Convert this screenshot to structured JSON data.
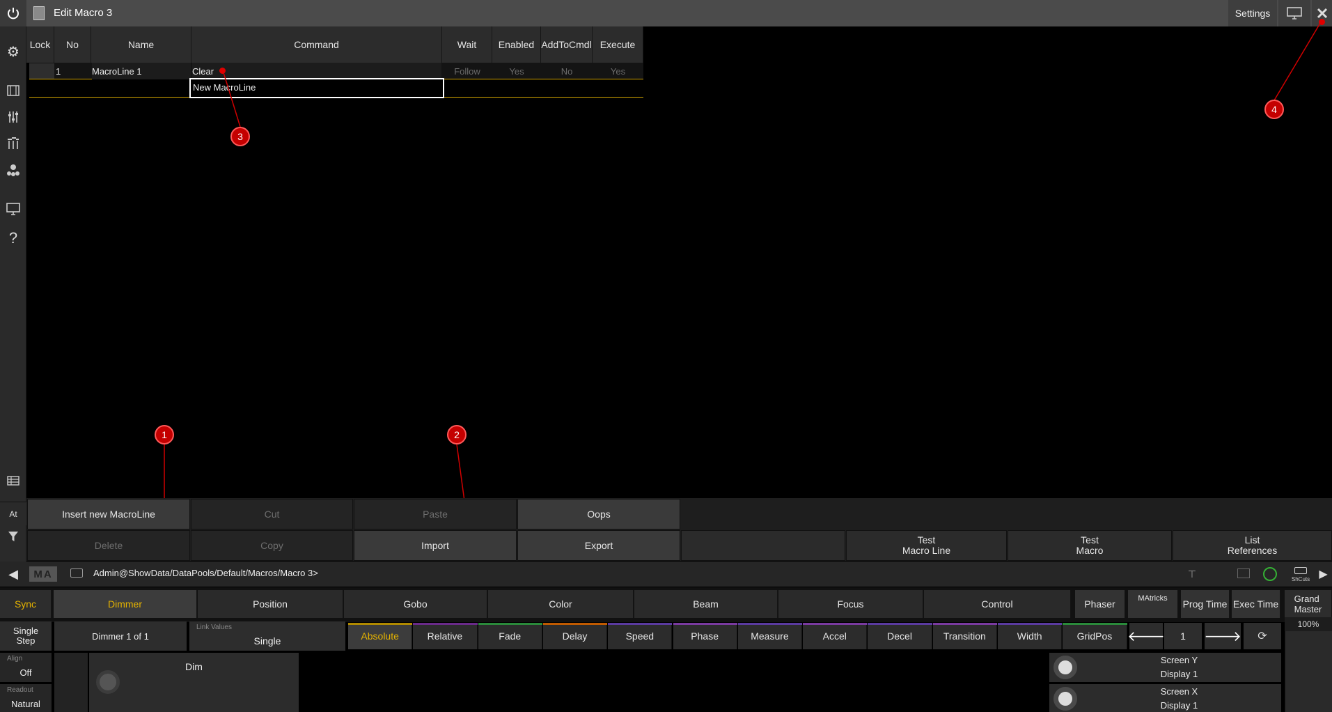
{
  "window": {
    "title": "Edit Macro 3",
    "settings_label": "Settings"
  },
  "sidebar": {
    "icons": [
      "power-icon",
      "gear-icon",
      "layout-icon",
      "faders-icon",
      "sliders-icon",
      "group-icon",
      "monitor-icon",
      "help-icon",
      "table-icon"
    ],
    "at_label": "At"
  },
  "table": {
    "headers": {
      "lock": "Lock",
      "no": "No",
      "name": "Name",
      "command": "Command",
      "wait": "Wait",
      "enabled": "Enabled",
      "addtocmdl": "AddToCmdl",
      "execute": "Execute"
    },
    "row": {
      "no": "1",
      "name": "MacroLine 1",
      "command": "Clear",
      "wait": "Follow",
      "enabled": "Yes",
      "addtocmdl": "No",
      "execute": "Yes"
    },
    "new_line": "New MacroLine"
  },
  "markers": [
    "1",
    "2",
    "3",
    "4"
  ],
  "actions": {
    "insert": "Insert new MacroLine",
    "cut": "Cut",
    "paste": "Paste",
    "oops": "Oops",
    "delete": "Delete",
    "copy": "Copy",
    "import": "Import",
    "export": "Export",
    "test_line": "Test\nMacro Line",
    "test_macro": "Test\nMacro",
    "list_refs": "List\nReferences"
  },
  "cmdline": {
    "logo": "MA",
    "path": "Admin@ShowData/DataPools/Default/Macros/Macro 3>",
    "shcuts": "ShCuts"
  },
  "attributes": {
    "sync": "Sync",
    "tabs": [
      "Dimmer",
      "Position",
      "Gobo",
      "Color",
      "Beam",
      "Focus",
      "Control"
    ],
    "phaser": "Phaser",
    "matricks": "MAtricks",
    "prog_time": "Prog Time",
    "exec_time": "Exec Time",
    "grand_master": "Grand\nMaster",
    "grand_value": "100%"
  },
  "functions": {
    "single_step": "Single\nStep",
    "dimmer_count": "Dimmer 1 of 1",
    "link_values_label": "Link Values",
    "link_values_value": "Single",
    "items": [
      "Absolute",
      "Relative",
      "Fade",
      "Delay",
      "Speed",
      "Phase",
      "Measure",
      "Accel",
      "Decel",
      "Transition",
      "Width",
      "GridPos"
    ],
    "page_value": "1"
  },
  "bottom": {
    "align_label": "Align",
    "align_value": "Off",
    "readout_label": "Readout",
    "readout_value": "Natural",
    "dim_label": "Dim",
    "encoder1_name": "Screen Y",
    "encoder1_sub": "Display 1",
    "encoder2_name": "Screen X",
    "encoder2_sub": "Display 1"
  },
  "colors": {
    "accent_yellow": "#e5b300",
    "marker_red": "#c40000",
    "title_bar": "#4b4b4b"
  }
}
